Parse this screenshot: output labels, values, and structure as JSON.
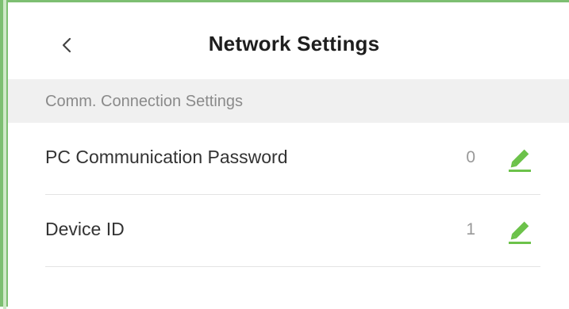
{
  "header": {
    "title": "Network Settings",
    "back_icon": "chevron-left-icon"
  },
  "section": {
    "label": "Comm. Connection Settings"
  },
  "rows": [
    {
      "label": "PC Communication Password",
      "value": "0",
      "icon": "pencil-edit-icon"
    },
    {
      "label": "Device ID",
      "value": "1",
      "icon": "pencil-edit-icon"
    }
  ],
  "colors": {
    "accent": "#6cc24a",
    "frame": "#7dbf72",
    "section_bg": "#f0f0f0",
    "divider": "#e4e4e4"
  }
}
